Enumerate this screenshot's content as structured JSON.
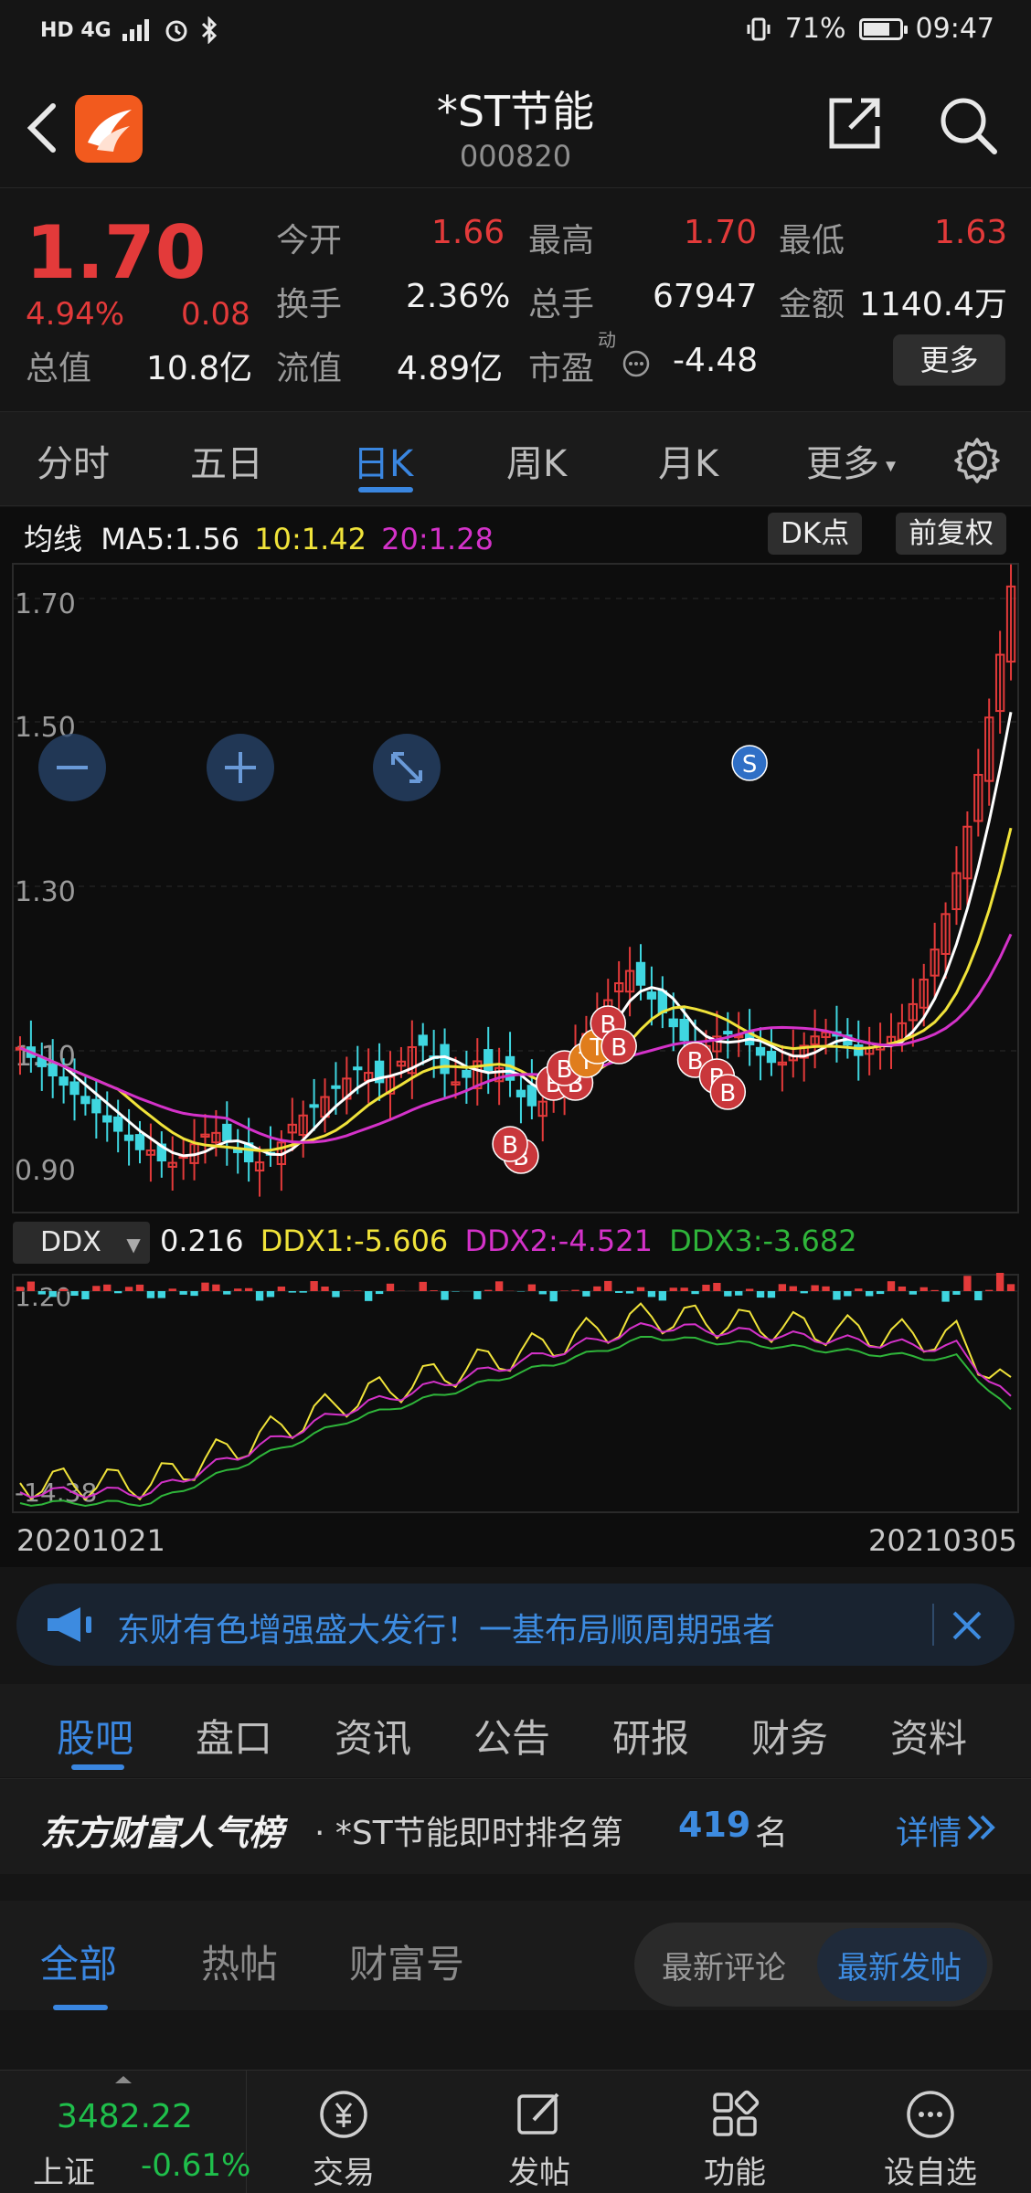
{
  "status_bar": {
    "left_icons": "HD 4G",
    "battery": "71%",
    "battery_level": 0.71,
    "time": "09:47"
  },
  "header": {
    "title": "*ST节能",
    "code": "000820"
  },
  "quote": {
    "price": "1.70",
    "change_pct": "4.94%",
    "change": "0.08",
    "open_label": "今开",
    "open": "1.66",
    "high_label": "最高",
    "high": "1.70",
    "low_label": "最低",
    "low": "1.63",
    "turnover_label": "换手",
    "turnover": "2.36%",
    "volume_label": "总手",
    "volume": "67947",
    "amount_label": "金额",
    "amount": "1140.4万",
    "total_mv_label": "总值",
    "total_mv": "10.8亿",
    "float_mv_label": "流值",
    "float_mv": "4.89亿",
    "pe_label": "市盈",
    "pe_sup": "动",
    "pe": "-4.48",
    "more": "更多"
  },
  "period_tabs": [
    "分时",
    "五日",
    "日K",
    "周K",
    "月K",
    "更多"
  ],
  "active_period": 2,
  "chart": {
    "ma_title": "均线",
    "ma5": "MA5:1.56",
    "ma10": "10:1.42",
    "ma20": "20:1.28",
    "dk_btn": "DK点",
    "adjust_btn": "前复权",
    "y_ticks": [
      "1.70",
      "1.50",
      "1.30",
      "1.10",
      "0.90"
    ],
    "ddx_select": "DDX",
    "ddx_value": "0.216",
    "ddx1": "DDX1:-5.606",
    "ddx2": "DDX2:-4.521",
    "ddx3": "DDX3:-3.682",
    "ddx_top": "1.20",
    "ddx_bottom": "-14.38",
    "date_start": "20201021",
    "date_end": "20210305",
    "signal_s": "S",
    "signal_b": "B",
    "signal_t": "T",
    "colors": {
      "ma5": "#ffffff",
      "ma10": "#f0e33a",
      "ma20": "#d432c9",
      "up": "#e33a3a",
      "down": "#3fd6e0"
    }
  },
  "banner": {
    "text": "东财有色增强盛大发行！一基布局顺周期强者"
  },
  "info_tabs": [
    "股吧",
    "盘口",
    "资讯",
    "公告",
    "研报",
    "财务",
    "资料"
  ],
  "rank": {
    "brand": "东方财富人气榜",
    "prefix": "· *ST节能即时排名第",
    "number": "419",
    "suffix": "名",
    "detail": "详情"
  },
  "feed_tabs": [
    "全部",
    "热帖",
    "财富号"
  ],
  "sort_options": [
    "最新评论",
    "最新发帖"
  ],
  "bottom_nav": {
    "index_value": "3482.22",
    "index_name": "上证",
    "index_change": "-0.61%",
    "items": [
      "交易",
      "发帖",
      "功能",
      "设自选"
    ]
  }
}
